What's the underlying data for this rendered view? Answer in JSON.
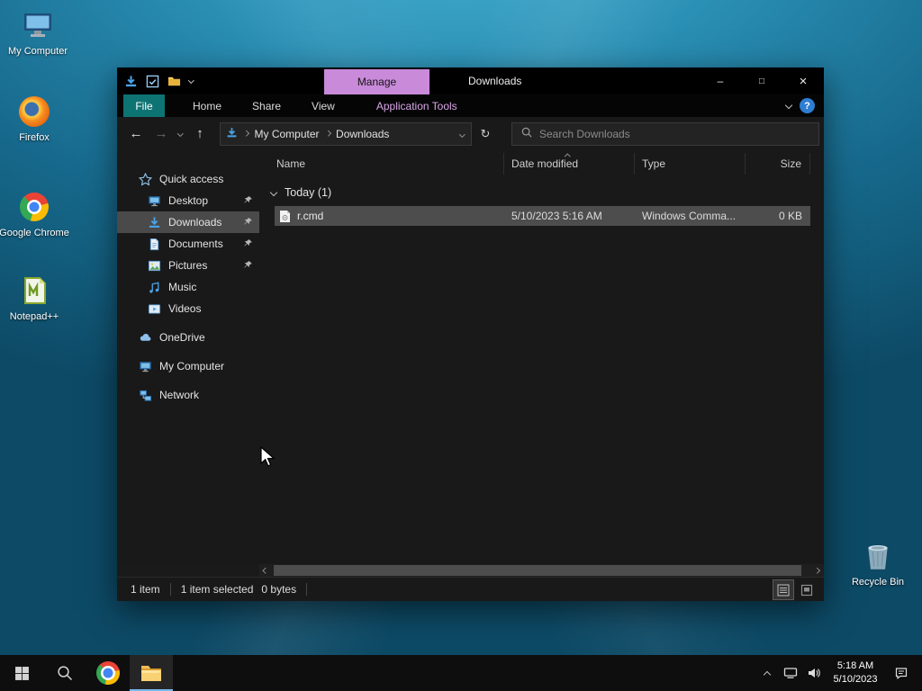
{
  "colors": {
    "accent_purple": "#c98ad9",
    "file_tab_teal": "#0e7373",
    "selection_gray": "#4d4d4d",
    "taskbar_active_underline": "#76b9ed"
  },
  "icons": {
    "back_arrow": "←",
    "forward_arrow": "→",
    "up_arrow": "↑",
    "refresh": "↻",
    "help": "?",
    "minimize": "–",
    "maximize": "□",
    "close": "×"
  },
  "desktop": {
    "icons": [
      {
        "label": "My Computer"
      },
      {
        "label": "Firefox"
      },
      {
        "label": "Google Chrome"
      },
      {
        "label": "Notepad++"
      },
      {
        "label": "Recycle Bin"
      }
    ]
  },
  "explorer": {
    "title": "Downloads",
    "manage_tab_label": "Manage",
    "ribbon_tabs": [
      {
        "label": "File"
      },
      {
        "label": "Home"
      },
      {
        "label": "Share"
      },
      {
        "label": "View"
      },
      {
        "label": "Application Tools"
      }
    ],
    "address_bar": {
      "breadcrumb": [
        "My Computer",
        "Downloads"
      ],
      "search_placeholder": "Search Downloads"
    },
    "sidebar": [
      {
        "label": "Quick access"
      },
      {
        "label": "Desktop"
      },
      {
        "label": "Downloads"
      },
      {
        "label": "Documents"
      },
      {
        "label": "Pictures"
      },
      {
        "label": "Music"
      },
      {
        "label": "Videos"
      },
      {
        "label": "OneDrive"
      },
      {
        "label": "My Computer"
      },
      {
        "label": "Network"
      }
    ],
    "columns": [
      "Name",
      "Date modified",
      "Type",
      "Size"
    ],
    "group_header": "Today (1)",
    "files": [
      {
        "name": "r.cmd",
        "date_modified": "5/10/2023 5:16 AM",
        "type": "Windows Comma...",
        "size": "0 KB"
      }
    ],
    "status_bar": {
      "item_count": "1 item",
      "selection_count": "1 item selected",
      "selection_size": "0 bytes"
    }
  },
  "taskbar": {
    "clock": {
      "time": "5:18 AM",
      "date": "5/10/2023"
    }
  }
}
